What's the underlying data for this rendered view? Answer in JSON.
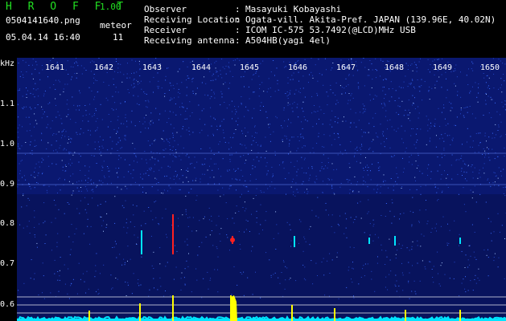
{
  "app": {
    "name": "H R O F F T",
    "version": "1.00"
  },
  "file": {
    "name": "0504141640.png",
    "datetime": "05.04.14 16:40"
  },
  "meteor": {
    "label": "meteor",
    "count": "11"
  },
  "info": [
    {
      "key": "Observer",
      "value": "Masayuki Kobayashi"
    },
    {
      "key": "Receiving Location",
      "value": "Ogata-vill. Akita-Pref. JAPAN (139.96E, 40.02N)"
    },
    {
      "key": "Receiver",
      "value": "ICOM IC-575 53.7492(@LCD)MHz USB"
    },
    {
      "key": "Receiving antenna",
      "value": "A504HB(yagi 4el)"
    }
  ],
  "spectrogram": {
    "y_unit": "kHz",
    "x_ticks": [
      "1641",
      "1642",
      "1643",
      "1644",
      "1645",
      "1646",
      "1647",
      "1648",
      "1649",
      "1650"
    ],
    "y_ticks": [
      "1.1",
      "1.0",
      "0.9",
      "0.8",
      "0.7",
      "0.6"
    ],
    "colors": {
      "bg": "#0a1870",
      "noise": "#3a6cff",
      "trace": "#00e5ff",
      "event": "#ffff00",
      "hot": "#ff2020"
    }
  }
}
